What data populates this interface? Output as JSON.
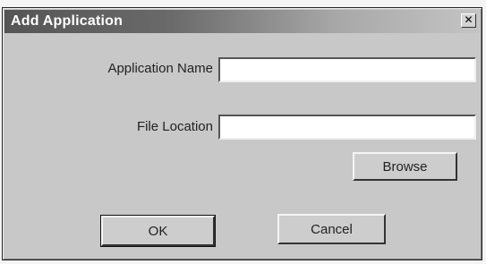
{
  "window": {
    "title": "Add Application",
    "close_glyph": "✕"
  },
  "form": {
    "app_name_label": "Application Name",
    "app_name_value": "",
    "file_location_label": "File Location",
    "file_location_value": ""
  },
  "buttons": {
    "browse": "Browse",
    "ok": "OK",
    "cancel": "Cancel"
  }
}
